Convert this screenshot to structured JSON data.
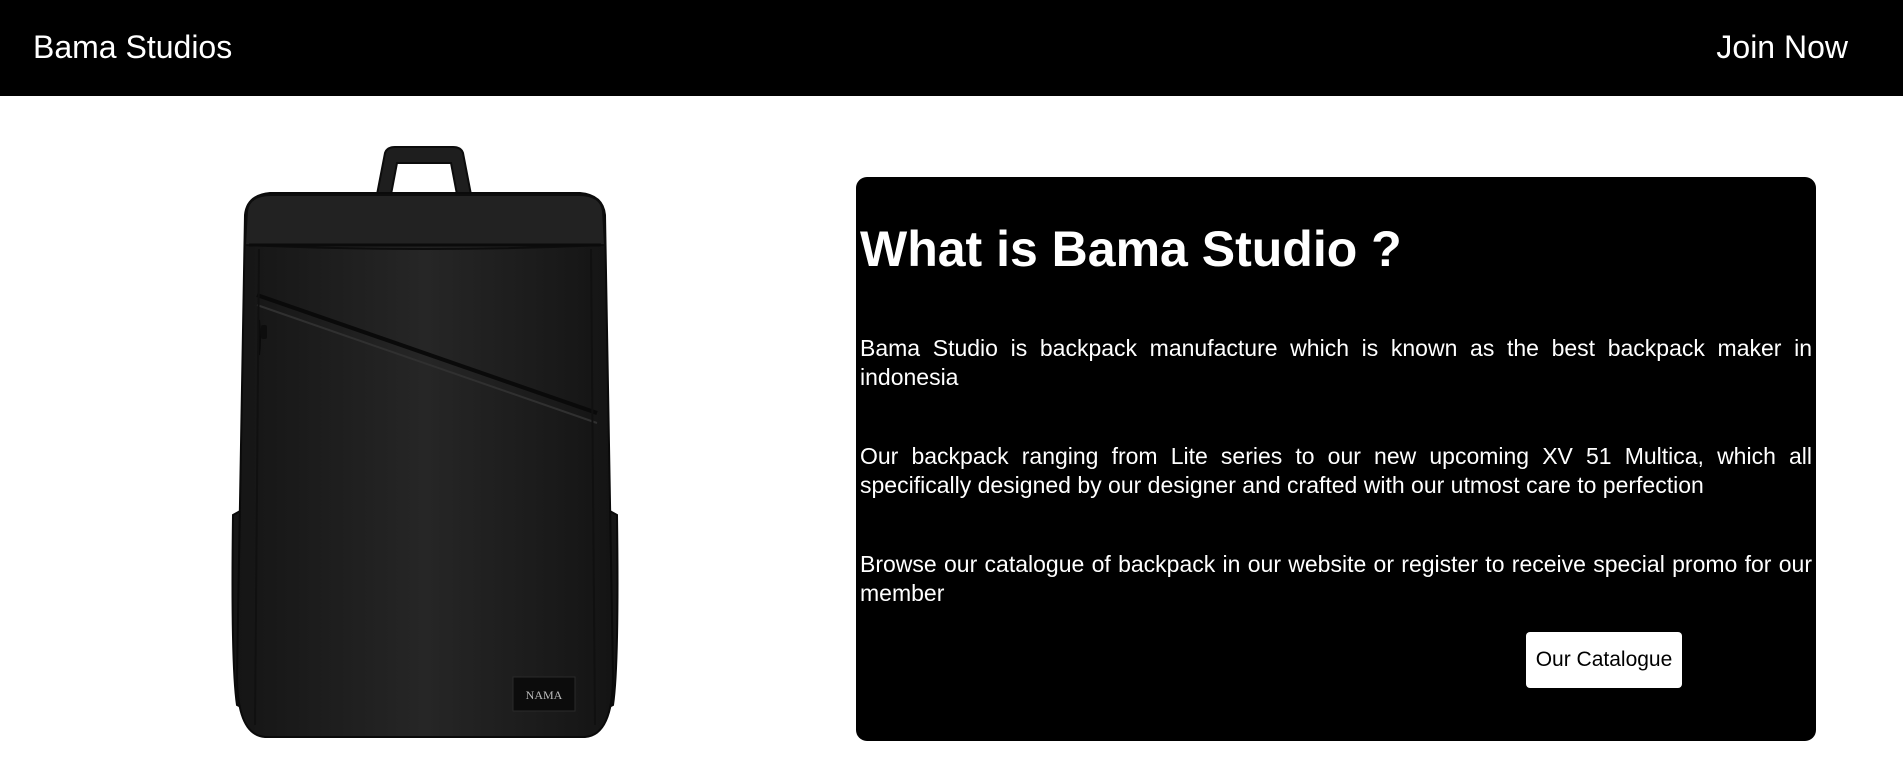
{
  "navbar": {
    "brand": "Bama Studios",
    "join_label": "Join Now"
  },
  "product": {
    "image_alt": "Black backpack",
    "tag_text": "NAMA"
  },
  "about": {
    "title": "What is Bama Studio ?",
    "paragraphs": [
      "Bama Studio is backpack manufacture which is known as the best backpack maker in indonesia",
      "Our backpack ranging from Lite series to our new upcoming XV 51 Multica, which all specifically designed by our designer and crafted with our utmost care to perfection",
      "Browse our catalogue of backpack in our website or register to receive special promo for our member"
    ],
    "catalogue_button": "Our Catalogue"
  },
  "colors": {
    "navbar_bg": "#000000",
    "card_bg": "#000000",
    "text_light": "#ffffff",
    "backpack": "#1c1c1c"
  }
}
